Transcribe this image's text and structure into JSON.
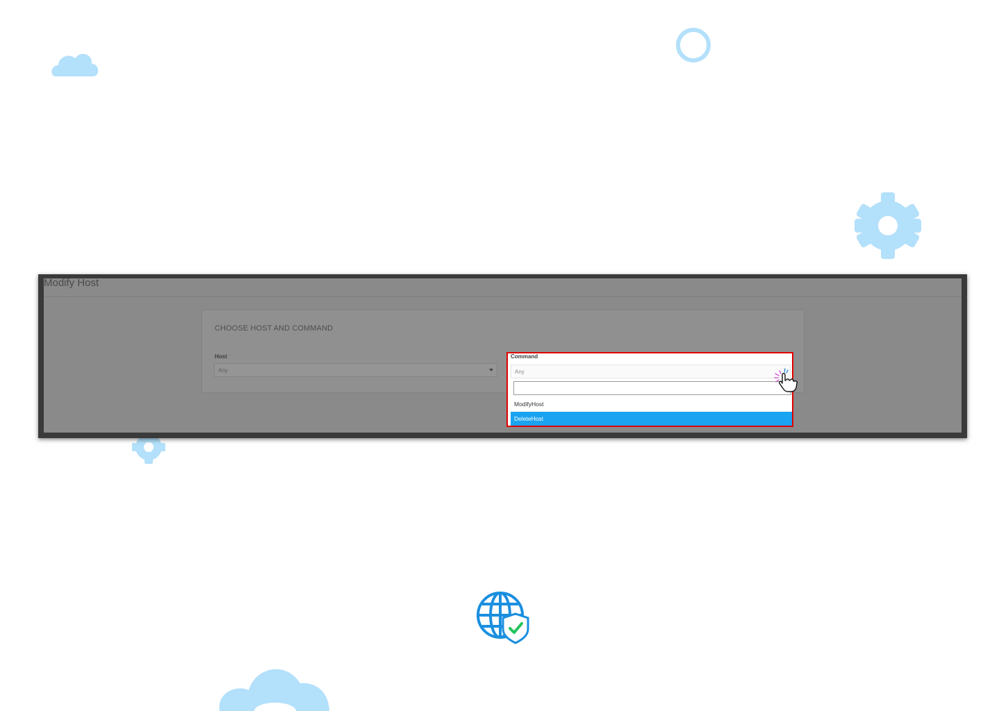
{
  "page": {
    "title": "Modify Host"
  },
  "card": {
    "title": "CHOOSE HOST AND COMMAND"
  },
  "host": {
    "label": "Host",
    "value": "Any"
  },
  "command": {
    "label": "Command",
    "value": "Any",
    "search_value": "",
    "options": [
      "ModifyHost",
      "DeleteHost"
    ],
    "highlighted": "DeleteHost"
  },
  "colors": {
    "highlight": "#1aa3f0",
    "callout_border": "#e00000",
    "decoration": "#b3e0fb"
  },
  "icons": {
    "decorations": [
      "cloud-icon",
      "ring-icon",
      "gear-icon",
      "gear-icon",
      "globe-shield-icon",
      "cloud-icon"
    ],
    "cursor": "hand-pointer-click-icon"
  }
}
